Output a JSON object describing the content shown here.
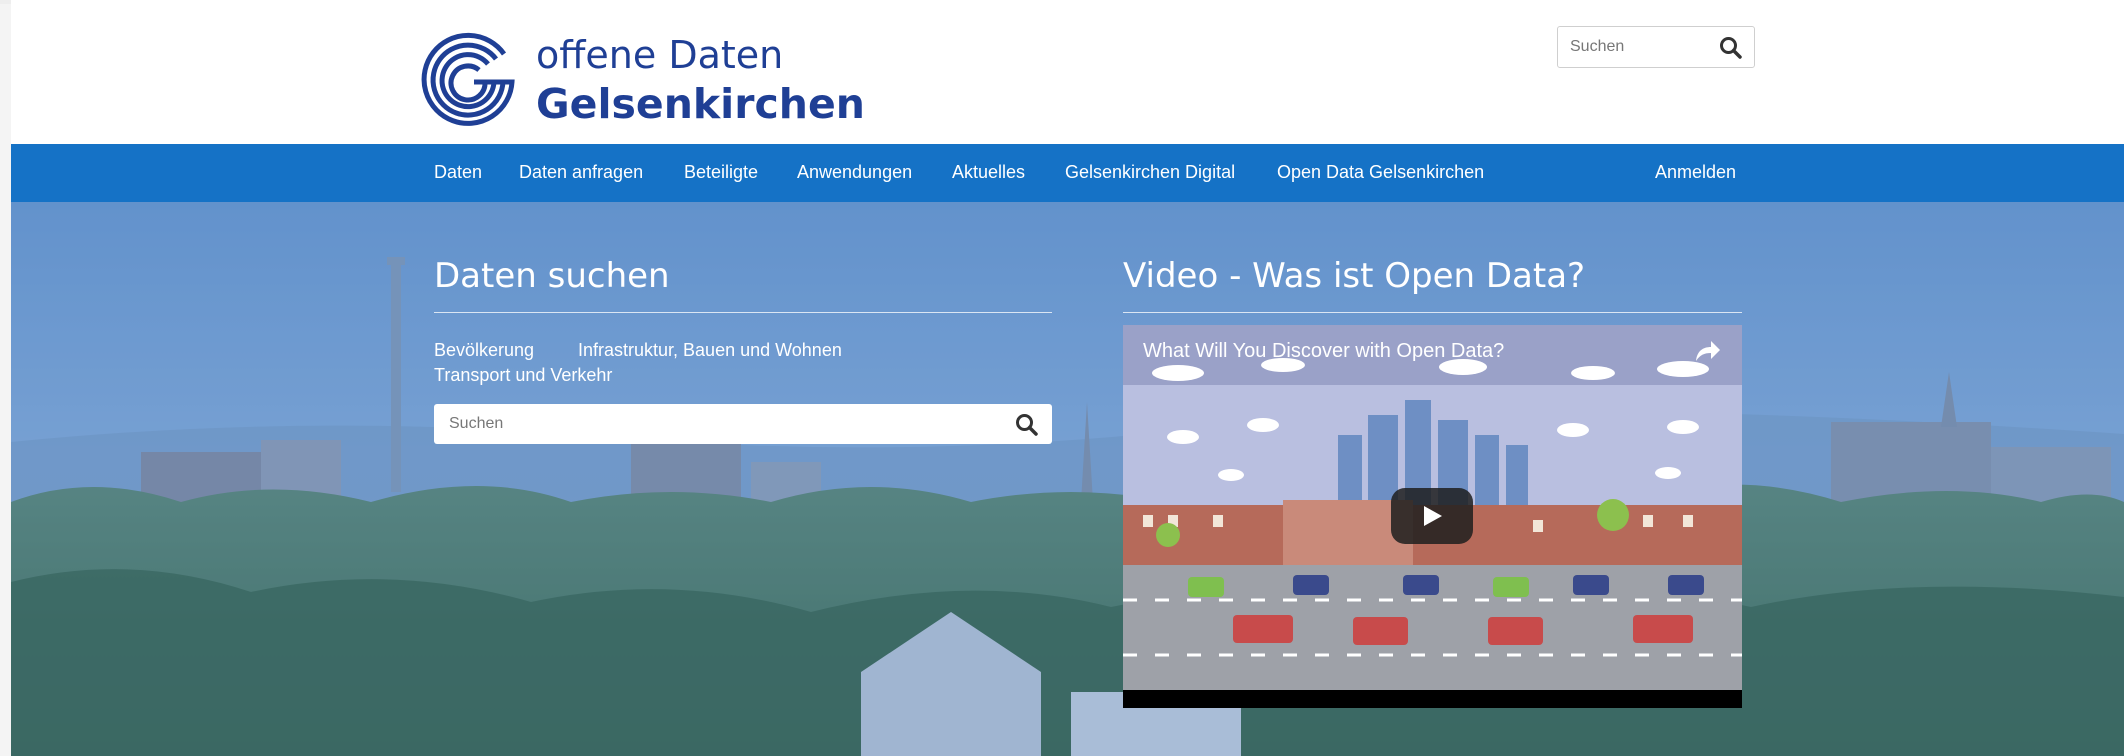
{
  "site": {
    "logo_line1": "offene Daten",
    "logo_line2": "Gelsenkirchen",
    "brand_color": "#1f3f95",
    "nav_color": "#1572c6"
  },
  "header_search": {
    "placeholder": "Suchen"
  },
  "nav": {
    "items": [
      "Daten",
      "Daten anfragen",
      "Beteiligte",
      "Anwendungen",
      "Aktuelles",
      "Gelsenkirchen Digital",
      "Open Data Gelsenkirchen"
    ],
    "login": "Anmelden"
  },
  "search_section": {
    "title": "Daten suchen",
    "topics": [
      "Bevölkerung",
      "Infrastruktur, Bauen und Wohnen",
      "Transport und Verkehr"
    ],
    "placeholder": "Suchen"
  },
  "video_section": {
    "title": "Video - Was ist Open Data?",
    "video_title": "What Will You Discover with Open Data?"
  },
  "icons": [
    "gelsenkirchen-logo-icon",
    "search-icon",
    "share-icon",
    "play-icon"
  ]
}
